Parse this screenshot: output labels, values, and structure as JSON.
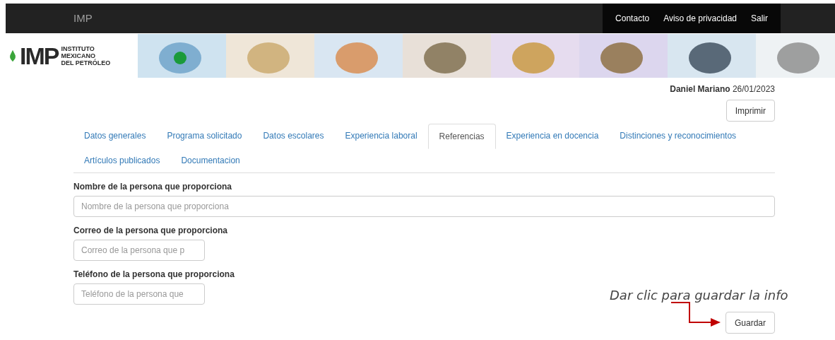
{
  "navbar": {
    "brand": "IMP",
    "links": [
      "Contacto",
      "Aviso de privacidad",
      "Salir"
    ]
  },
  "logo": {
    "mark": "IMP",
    "lines": [
      "INSTITUTO",
      "MEXICANO",
      "DEL PETRÓLEO"
    ]
  },
  "user": {
    "name": "Daniel Mariano",
    "date": "26/01/2023"
  },
  "print_button": "Imprimir",
  "tabs": [
    {
      "label": "Datos generales",
      "selected": false
    },
    {
      "label": "Programa solicitado",
      "selected": false
    },
    {
      "label": "Datos escolares",
      "selected": false
    },
    {
      "label": "Experiencia laboral",
      "selected": false
    },
    {
      "label": "Referencias",
      "selected": true
    },
    {
      "label": "Experiencia en docencia",
      "selected": false
    },
    {
      "label": "Distinciones y reconocimientos",
      "selected": false
    },
    {
      "label": "Artículos publicados",
      "selected": false
    },
    {
      "label": "Documentacion",
      "selected": false
    }
  ],
  "fields": [
    {
      "label": "Nombre de la persona que proporciona",
      "placeholder": "Nombre de la persona que proporciona",
      "kind": "wide"
    },
    {
      "label": "Correo de la persona que proporciona",
      "placeholder": "Correo de la persona que p",
      "kind": "narrow"
    },
    {
      "label": "Teléfono de la persona que proporciona",
      "placeholder": "Teléfono de la persona que",
      "kind": "narrow"
    }
  ],
  "hint": "Dar clic para guardar la info",
  "save_button": "Guardar"
}
